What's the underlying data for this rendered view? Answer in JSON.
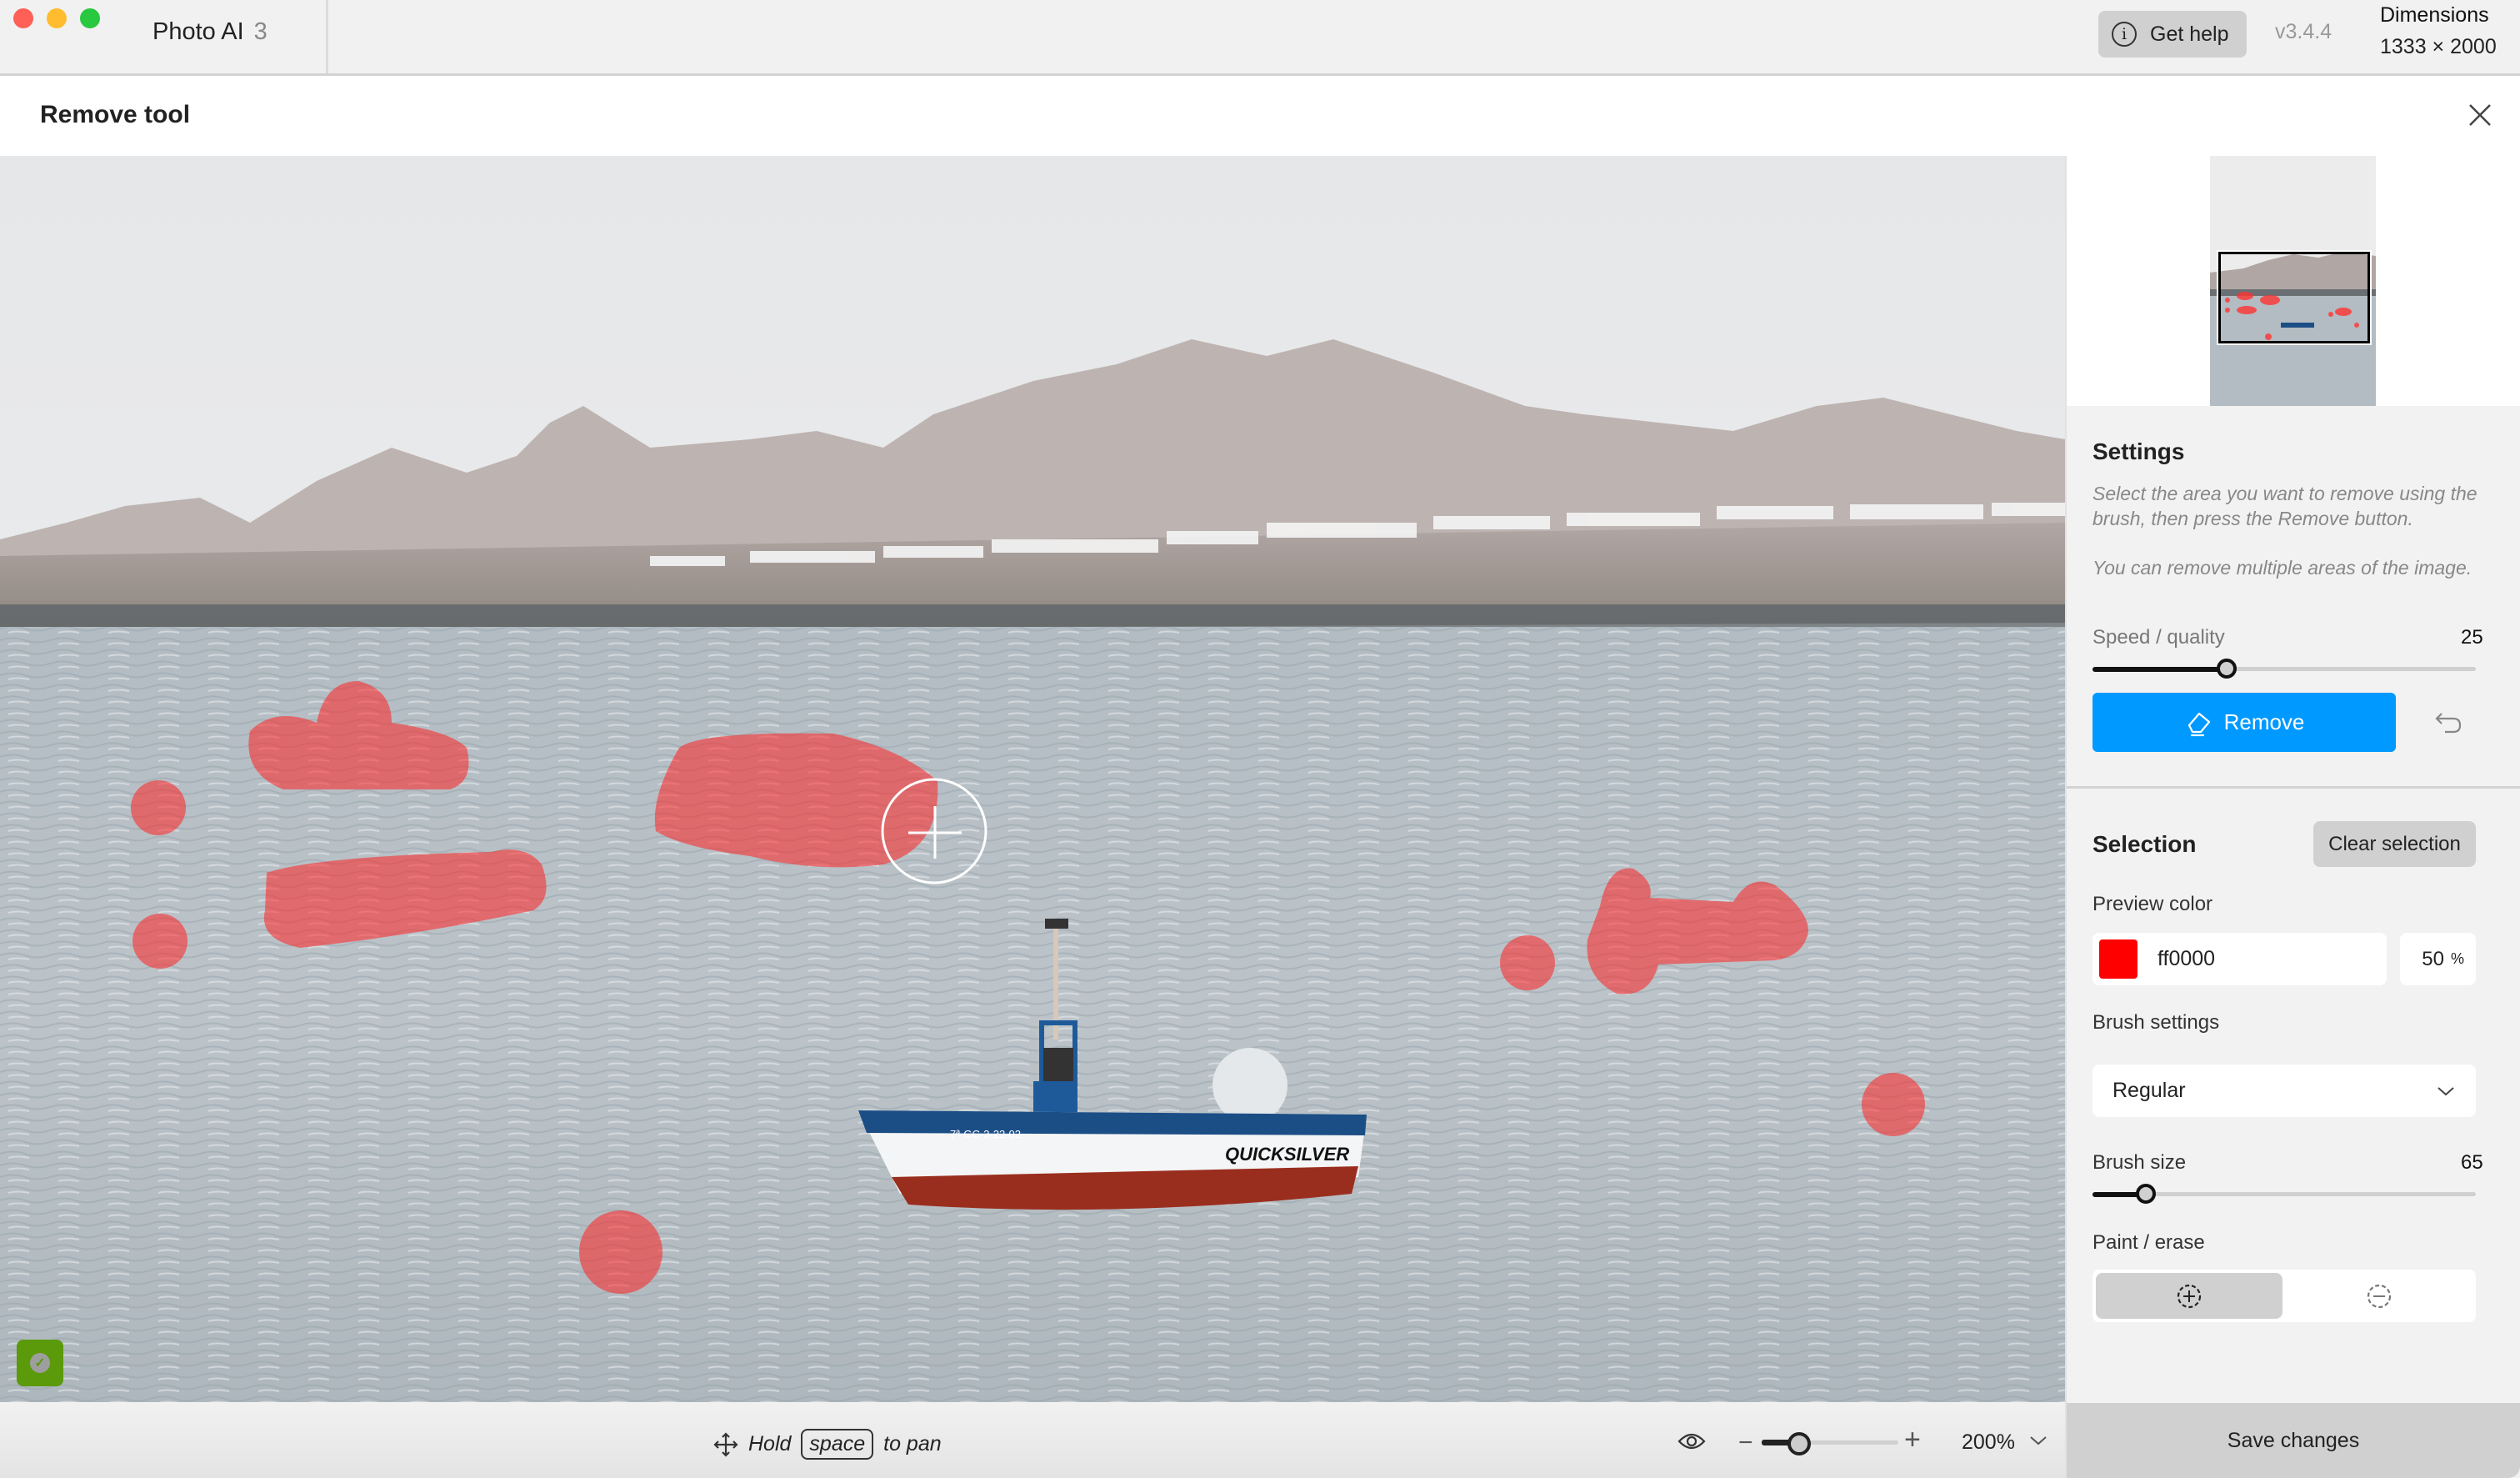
{
  "window": {
    "app_name": "Photo AI",
    "app_version_major": "3",
    "help_button_label": "Get help",
    "version": "v3.4.4",
    "dimensions_label": "Dimensions",
    "dimensions_value": "1333 × 2000"
  },
  "header": {
    "title": "Remove tool",
    "close_icon": "close-icon"
  },
  "canvas": {
    "status_badge_icon": "check-icon",
    "brush_cursor_icon": "crosshair-plus-icon",
    "selection_color": "#ff0000",
    "selection_opacity_percent": 50
  },
  "bottombar": {
    "pan_icon": "move-arrows-icon",
    "hint_hold": "Hold",
    "hint_key": "space",
    "hint_to_pan": "to pan",
    "preview_icon": "eye-icon",
    "zoom_out_icon": "minus-icon",
    "zoom_in_icon": "plus-icon",
    "zoom_slider_fraction": 0.15,
    "zoom_value": "200%",
    "zoom_dropdown_icon": "chevron-down-icon"
  },
  "panel": {
    "settings": {
      "title": "Settings",
      "help_1": "Select the area you want to remove using the brush, then press the Remove button.",
      "help_2": "You can remove multiple areas of the image.",
      "speed_quality_label": "Speed / quality",
      "speed_quality_value": "25",
      "speed_quality_fraction": 0.35,
      "remove_button_label": "Remove",
      "remove_icon": "eraser-icon",
      "undo_icon": "undo-icon"
    },
    "selection": {
      "title": "Selection",
      "clear_button_label": "Clear selection",
      "preview_color_label": "Preview color",
      "preview_color_hex": "ff0000",
      "preview_color_swatch": "#ff0000",
      "opacity_value": "50",
      "opacity_unit": "%",
      "brush_settings_label": "Brush settings",
      "brush_mode": "Regular",
      "brush_size_label": "Brush size",
      "brush_size_value": "65",
      "brush_size_fraction": 0.14,
      "paint_erase_label": "Paint / erase",
      "paint_icon": "paint-add-icon",
      "erase_icon": "erase-subtract-icon",
      "active_mode": "paint"
    },
    "save_button_label": "Save changes"
  },
  "colors": {
    "accent": "#0099ff",
    "status_ok": "#5b9a0b"
  }
}
